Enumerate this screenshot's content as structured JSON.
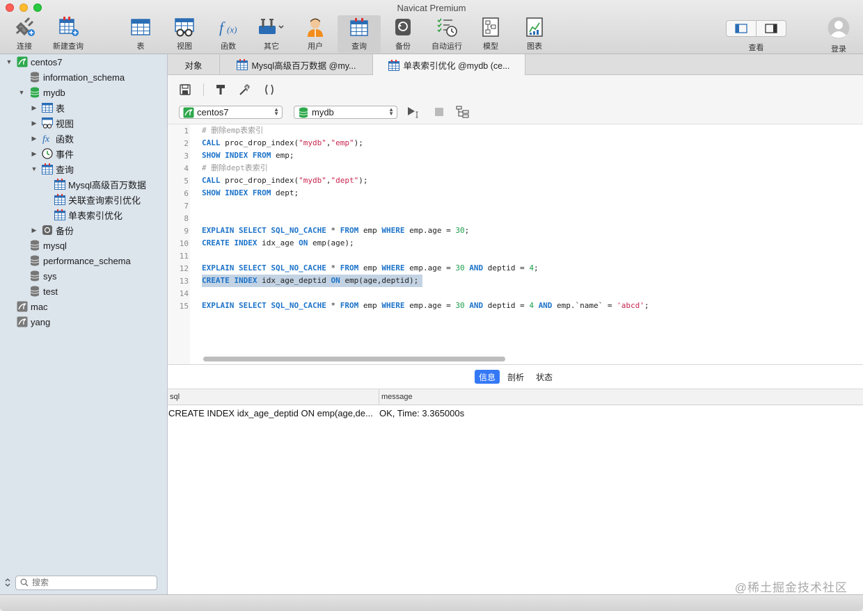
{
  "app_title": "Navicat Premium",
  "toolbar": {
    "items": [
      {
        "label": "连接"
      },
      {
        "label": "新建查询"
      },
      {
        "label": "表"
      },
      {
        "label": "视图"
      },
      {
        "label": "函数"
      },
      {
        "label": "其它"
      },
      {
        "label": "用户"
      },
      {
        "label": "查询"
      },
      {
        "label": "备份"
      },
      {
        "label": "自动运行"
      },
      {
        "label": "模型"
      },
      {
        "label": "图表"
      }
    ],
    "view_label": "查看",
    "login_label": "登录"
  },
  "sidebar": {
    "tree": [
      {
        "label": "centos7"
      },
      {
        "label": "information_schema"
      },
      {
        "label": "mydb"
      },
      {
        "label": "表"
      },
      {
        "label": "视图"
      },
      {
        "label": "函数"
      },
      {
        "label": "事件"
      },
      {
        "label": "查询"
      },
      {
        "label": "Mysql高级百万数据"
      },
      {
        "label": "关联查询索引优化"
      },
      {
        "label": "单表索引优化"
      },
      {
        "label": "备份"
      },
      {
        "label": "mysql"
      },
      {
        "label": "performance_schema"
      },
      {
        "label": "sys"
      },
      {
        "label": "test"
      },
      {
        "label": "mac"
      },
      {
        "label": "yang"
      }
    ],
    "search_placeholder": "搜索"
  },
  "tabs": [
    {
      "label": "对象"
    },
    {
      "label": "Mysql高级百万数据 @my..."
    },
    {
      "label": "单表索引优化 @mydb (ce..."
    }
  ],
  "editor": {
    "connection": "centos7",
    "database": "mydb",
    "line_numbers": [
      "1",
      "2",
      "3",
      "4",
      "5",
      "6",
      "7",
      "8",
      "9",
      "10",
      "11",
      "12",
      "13",
      "14",
      "15"
    ],
    "lines": [
      "# 删除emp表索引",
      "CALL proc_drop_index(\"mydb\",\"emp\");",
      "SHOW INDEX FROM emp;",
      "# 删除dept表索引",
      "CALL proc_drop_index(\"mydb\",\"dept\");",
      "SHOW INDEX FROM dept;",
      "",
      "",
      "EXPLAIN SELECT SQL_NO_CACHE * FROM emp WHERE emp.age = 30;",
      "CREATE INDEX idx_age ON emp(age);",
      "",
      "EXPLAIN SELECT SQL_NO_CACHE * FROM emp WHERE emp.age = 30 AND deptid = 4;",
      "CREATE INDEX idx_age_deptid ON emp(age,deptid);",
      "",
      "EXPLAIN SELECT SQL_NO_CACHE * FROM emp WHERE emp.age = 30 AND deptid = 4 AND emp.`name` = 'abcd';"
    ],
    "selected_line": 13
  },
  "result_tabs": [
    {
      "label": "信息"
    },
    {
      "label": "剖析"
    },
    {
      "label": "状态"
    }
  ],
  "grid": {
    "columns": [
      "sql",
      "message"
    ],
    "rows": [
      [
        "CREATE INDEX idx_age_deptid ON emp(age,de...",
        "OK, Time: 3.365000s"
      ]
    ]
  },
  "watermark": "@稀土掘金技术社区"
}
